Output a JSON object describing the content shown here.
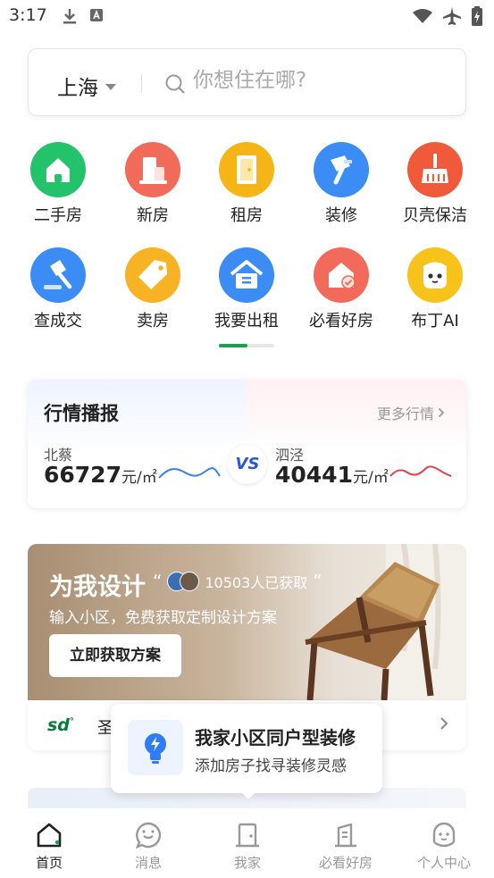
{
  "status": {
    "time": "3:17"
  },
  "search": {
    "city": "上海",
    "placeholder": "你想住在哪?"
  },
  "grid": [
    {
      "label": "二手房",
      "icon": "house-icon",
      "color": "#22c36a"
    },
    {
      "label": "新房",
      "icon": "building-icon",
      "color": "#f26a5a"
    },
    {
      "label": "租房",
      "icon": "door-icon",
      "color": "#f5b517"
    },
    {
      "label": "装修",
      "icon": "paint-roller-icon",
      "color": "#3b8cf5"
    },
    {
      "label": "贝壳保洁",
      "icon": "broom-icon",
      "color": "#f05a3a"
    },
    {
      "label": "查成交",
      "icon": "gavel-icon",
      "color": "#3b8cf5"
    },
    {
      "label": "卖房",
      "icon": "tag-icon",
      "color": "#f7b324"
    },
    {
      "label": "我要出租",
      "icon": "rent-house-icon",
      "color": "#3b8cf5"
    },
    {
      "label": "必看好房",
      "icon": "check-house-icon",
      "color": "#f26a5a"
    },
    {
      "label": "布丁AI",
      "icon": "ai-bot-icon",
      "color": "#f7c21a"
    }
  ],
  "market": {
    "title": "行情播报",
    "more": "更多行情",
    "left": {
      "name": "北蔡",
      "price": "66727",
      "unit": "元/㎡",
      "color": "#3b7cf0"
    },
    "vs": "VS",
    "right": {
      "name": "泗泾",
      "price": "40441",
      "unit": "元/㎡",
      "color": "#e0424b"
    }
  },
  "banner": {
    "title": "为我设计",
    "count_text": "10503人已获取",
    "subtitle": "输入小区，免费获取定制设计方案",
    "button": "立即获取方案"
  },
  "brand": {
    "logo": "sd",
    "text": "圣"
  },
  "tooltip": {
    "title": "我家小区同户型装修",
    "subtitle": "添加房子找寻装修灵感"
  },
  "tabs": [
    {
      "label": "首页",
      "icon": "home-icon",
      "active": true
    },
    {
      "label": "消息",
      "icon": "message-icon",
      "active": false
    },
    {
      "label": "我家",
      "icon": "my-home-icon",
      "active": false
    },
    {
      "label": "必看好房",
      "icon": "good-house-icon",
      "active": false
    },
    {
      "label": "个人中心",
      "icon": "profile-icon",
      "active": false
    }
  ]
}
